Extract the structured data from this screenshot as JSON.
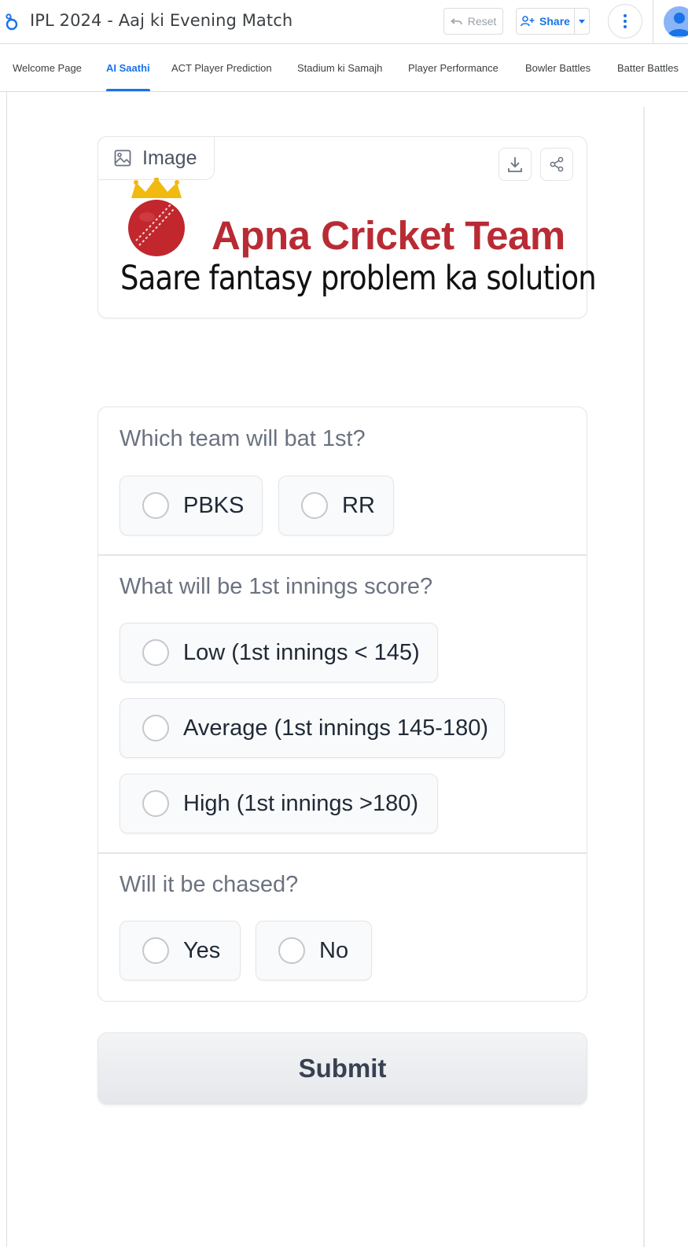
{
  "header": {
    "app_title": "IPL 2024 - Aaj ki Evening Match",
    "reset_label": "Reset",
    "share_label": "Share"
  },
  "tabs": [
    {
      "label": "Welcome Page",
      "active": false
    },
    {
      "label": "AI Saathi",
      "active": true
    },
    {
      "label": "ACT Player Prediction",
      "active": false
    },
    {
      "label": "Stadium ki Samajh",
      "active": false
    },
    {
      "label": "Player Performance",
      "active": false
    },
    {
      "label": "Bowler Battles",
      "active": false
    },
    {
      "label": "Batter Battles",
      "active": false
    }
  ],
  "image_card": {
    "label": "Image",
    "brand_title": "Apna Cricket Team",
    "brand_tagline": "Saare fantasy problem ka solution"
  },
  "questions": [
    {
      "label": "Which team will bat 1st?",
      "options": [
        "PBKS",
        "RR"
      ]
    },
    {
      "label": "What will be 1st innings score?",
      "options": [
        "Low (1st innings < 145)",
        "Average (1st innings 145-180)",
        "High (1st innings >180)"
      ]
    },
    {
      "label": "Will it be chased?",
      "options": [
        "Yes",
        "No"
      ]
    }
  ],
  "submit_label": "Submit",
  "colors": {
    "accent": "#1a73e8",
    "brand_red": "#b92b34",
    "crown_gold": "#f2b90f"
  }
}
